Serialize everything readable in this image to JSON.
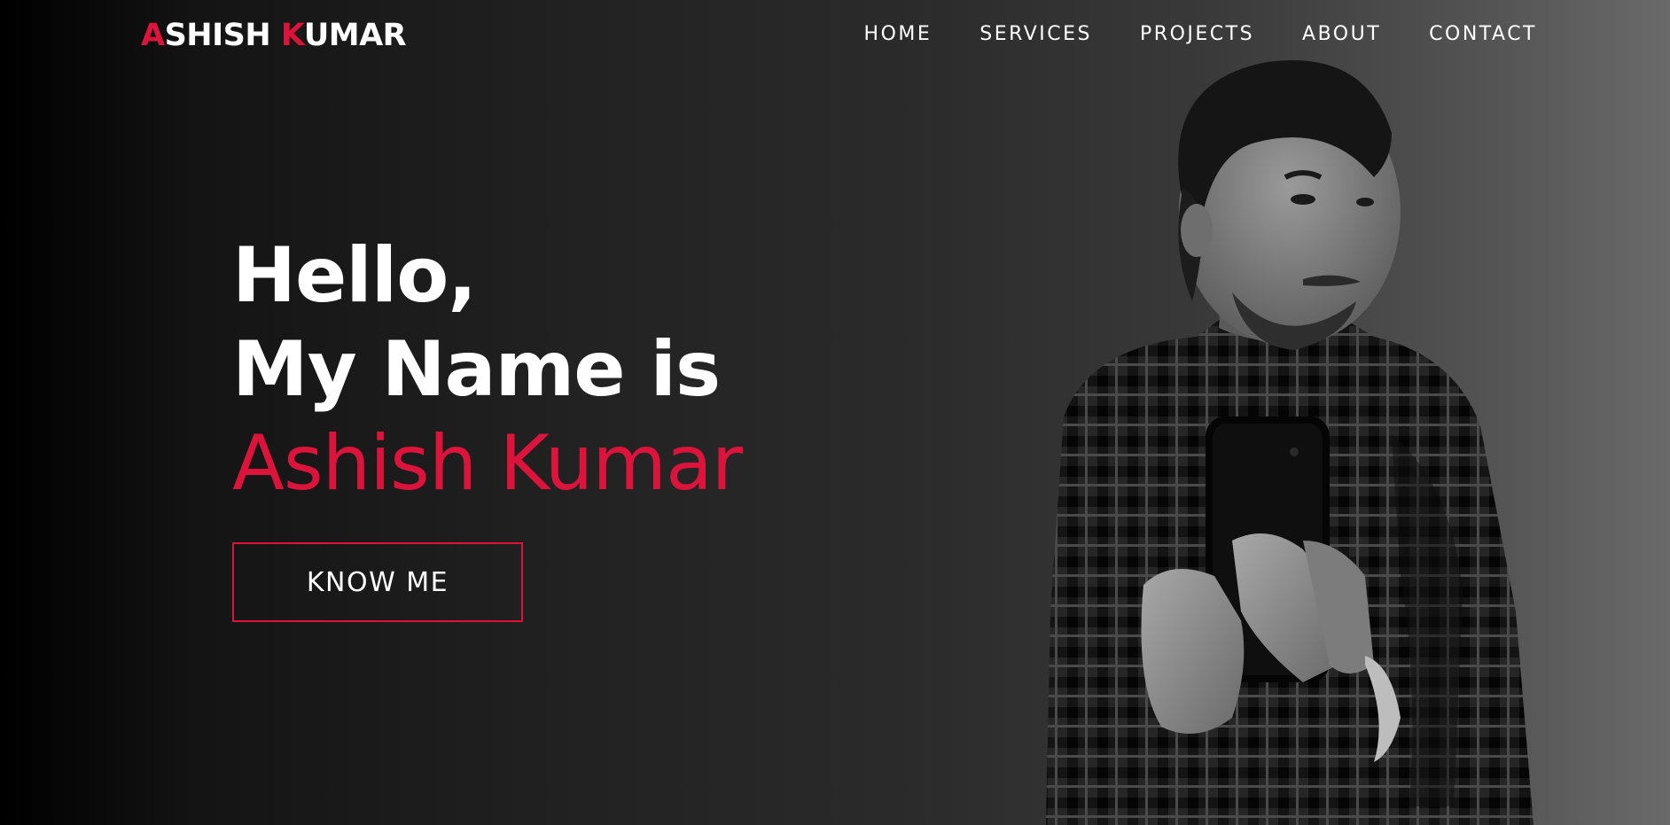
{
  "header": {
    "logo": {
      "first_initial": "A",
      "first_rest": "SHISH ",
      "last_initial": "K",
      "last_rest": "UMAR"
    },
    "nav": [
      "HOME",
      "SERVICES",
      "PROJECTS",
      "ABOUT",
      "CONTACT"
    ]
  },
  "hero": {
    "greeting": "Hello,",
    "intro": "My Name is",
    "name": "Ashish Kumar",
    "cta_label": "KNOW ME"
  },
  "colors": {
    "accent": "#dc143c",
    "text": "#ffffff"
  },
  "photo": {
    "icon": "portrait-photo"
  }
}
